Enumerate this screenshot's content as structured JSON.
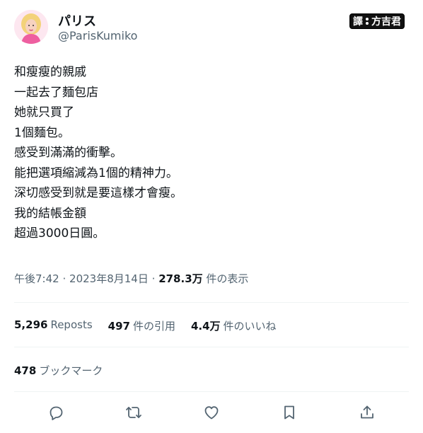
{
  "author": {
    "display_name": "パリス",
    "handle": "@ParisKumiko"
  },
  "watermark": {
    "prefix": "譯",
    "credit": "方吉君"
  },
  "tweet": {
    "lines": [
      "和瘦瘦的親戚",
      "一起去了麵包店",
      "她就只買了",
      "1個麵包。",
      "感受到滿滿的衝擊。",
      "能把選項縮減為1個的精神力。",
      "深切感受到就是要這樣才會瘦。",
      "我的結帳金額",
      "超過3000日圓。"
    ],
    "time": "午後7:42",
    "date": "2023年8月14日",
    "separator": "·",
    "views_count": "278.3万",
    "views_label": "件の表示"
  },
  "stats": {
    "reposts_count": "5,296",
    "reposts_label": "Reposts",
    "quotes_count": "497",
    "quotes_label": "件の引用",
    "likes_count": "4.4万",
    "likes_label": "件のいいね",
    "bookmarks_count": "478",
    "bookmarks_label": "ブックマーク"
  },
  "actions": [
    "reply-icon",
    "retweet-icon",
    "like-icon",
    "bookmark-icon",
    "share-icon"
  ]
}
